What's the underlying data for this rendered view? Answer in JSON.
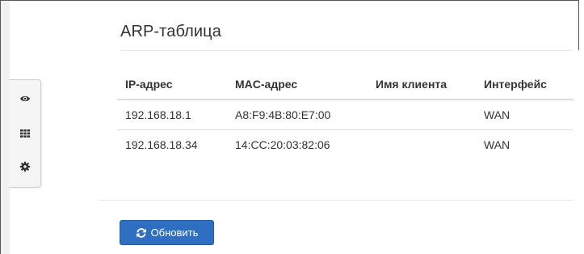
{
  "page": {
    "title": "ARP-таблица"
  },
  "side_toolbar": {
    "items": [
      {
        "icon": "eye-icon"
      },
      {
        "icon": "grid-icon"
      },
      {
        "icon": "gear-icon"
      }
    ]
  },
  "arp_table": {
    "columns": [
      "IP-адрес",
      "MAC-адрес",
      "Имя клиента",
      "Интерфейс"
    ],
    "rows": [
      {
        "ip": "192.168.18.1",
        "mac": "A8:F9:4B:80:E7:00",
        "client_name": "",
        "interface": "WAN"
      },
      {
        "ip": "192.168.18.34",
        "mac": "14:CC:20:03:82:06",
        "client_name": "",
        "interface": "WAN"
      }
    ]
  },
  "actions": {
    "refresh_label": "Обновить",
    "refresh_icon": "refresh-icon"
  },
  "colors": {
    "primary_button": "#2f6fc1",
    "text": "#333333"
  }
}
